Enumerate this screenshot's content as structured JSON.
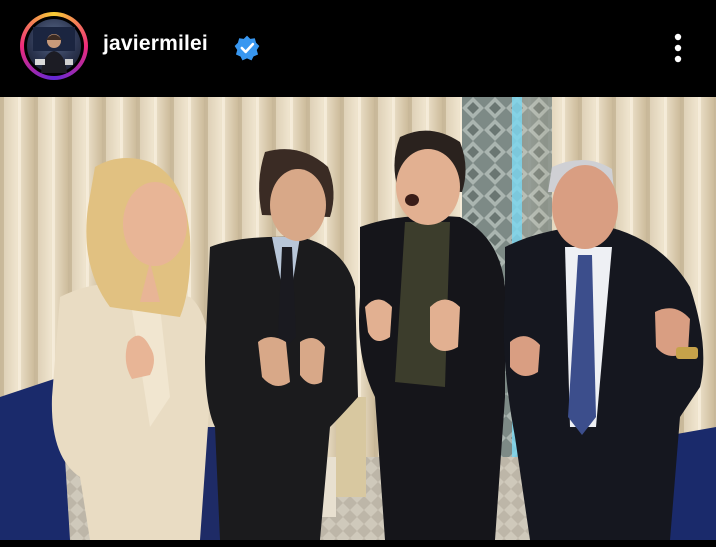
{
  "post": {
    "username": "javiermilei",
    "verified": true,
    "more_icon": "more-vertical-icon",
    "avatar_icon": "profile-avatar",
    "verified_icon": "verified-badge-icon"
  },
  "colors": {
    "background": "#000000",
    "text": "#ffffff",
    "verified_blue": "#3897f0",
    "ring": [
      "#f9ce34",
      "#ee2a7b",
      "#6228d7"
    ]
  }
}
